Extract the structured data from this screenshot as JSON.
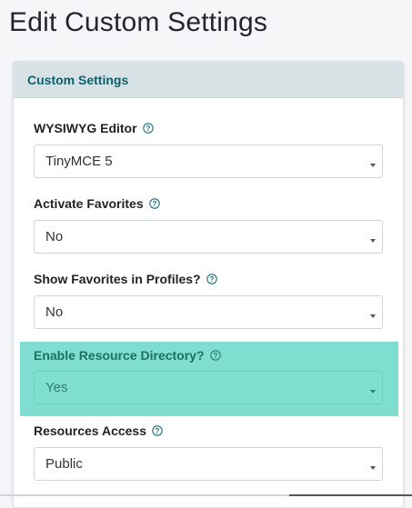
{
  "page": {
    "title": "Edit Custom Settings"
  },
  "card": {
    "header_title": "Custom Settings"
  },
  "fields": [
    {
      "label": "WYSIWYG Editor",
      "value": "TinyMCE 5",
      "help_icon": "question-circle-icon"
    },
    {
      "label": "Activate Favorites",
      "value": "No",
      "help_icon": "question-circle-icon"
    },
    {
      "label": "Show Favorites in Profiles?",
      "value": "No",
      "help_icon": "question-circle-icon"
    },
    {
      "label": "Enable Resource Directory?",
      "value": "Yes",
      "help_icon": "question-circle-icon",
      "highlighted": true
    },
    {
      "label": "Resources Access",
      "value": "Public",
      "help_icon": "question-circle-icon"
    }
  ],
  "colors": {
    "header_bg": "#d6e2e6",
    "header_text": "#0f5f6b",
    "highlight": "#7fded0",
    "help_icon": "#1a6f7f"
  }
}
